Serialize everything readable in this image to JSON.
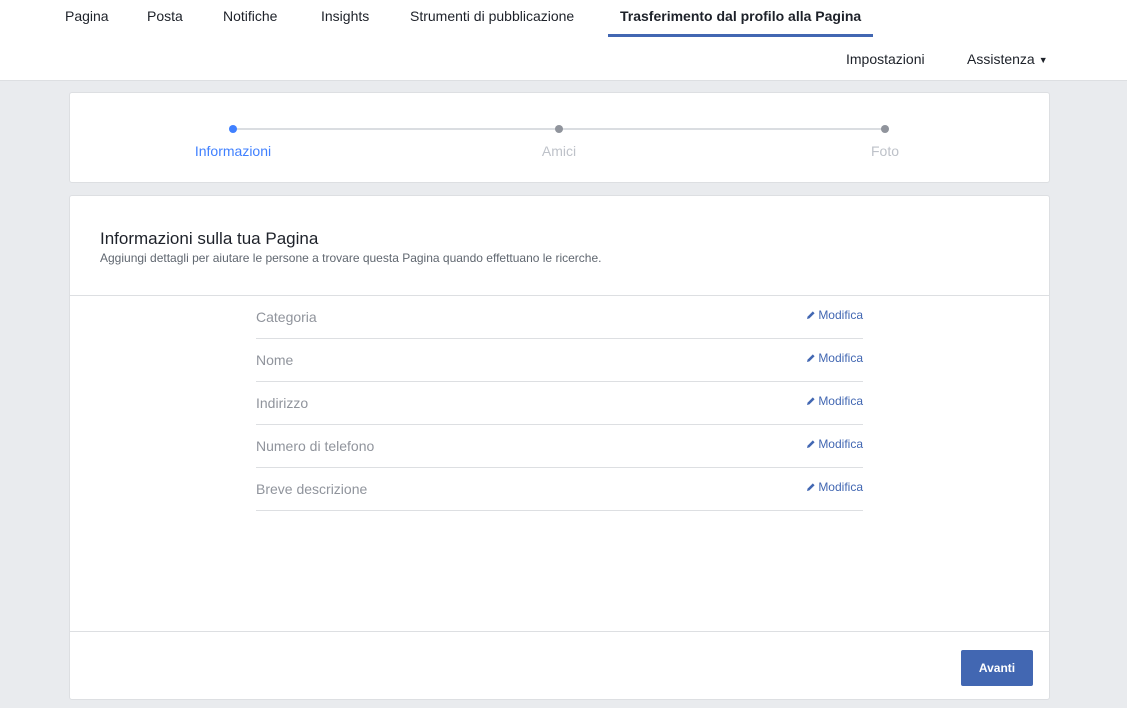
{
  "tabs": [
    {
      "label": "Pagina"
    },
    {
      "label": "Posta"
    },
    {
      "label": "Notifiche"
    },
    {
      "label": "Insights"
    },
    {
      "label": "Strumenti di pubblicazione"
    },
    {
      "label": "Trasferimento dal profilo alla Pagina",
      "active": true
    }
  ],
  "subnav": {
    "settings": "Impostazioni",
    "help": "Assistenza"
  },
  "stepper": {
    "steps": [
      {
        "label": "Informazioni",
        "active": true
      },
      {
        "label": "Amici",
        "active": false
      },
      {
        "label": "Foto",
        "active": false
      }
    ]
  },
  "info": {
    "title": "Informazioni sulla tua Pagina",
    "subtitle": "Aggiungi dettagli per aiutare le persone a trovare questa Pagina quando effettuano le ricerche.",
    "edit_label": "Modifica",
    "rows": [
      {
        "label": "Categoria"
      },
      {
        "label": "Nome"
      },
      {
        "label": "Indirizzo"
      },
      {
        "label": "Numero di telefono"
      },
      {
        "label": "Breve descrizione"
      }
    ]
  },
  "footer": {
    "next_label": "Avanti"
  },
  "colors": {
    "accent": "#4267b2",
    "active_step": "#4080ff",
    "background": "#e9ebee"
  }
}
